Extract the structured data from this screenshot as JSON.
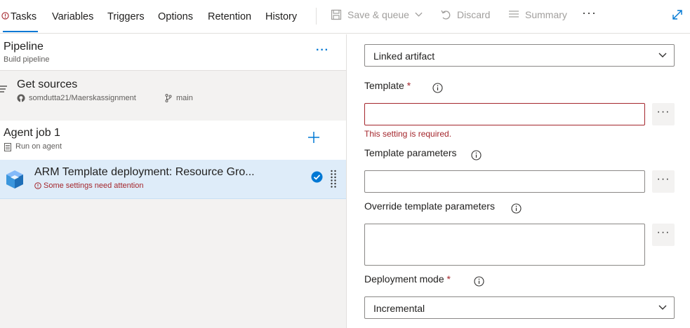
{
  "tabs": [
    {
      "label": "Tasks"
    },
    {
      "label": "Variables"
    },
    {
      "label": "Triggers"
    },
    {
      "label": "Options"
    },
    {
      "label": "Retention"
    },
    {
      "label": "History"
    }
  ],
  "toolbar": {
    "save_label": "Save & queue",
    "discard_label": "Discard",
    "summary_label": "Summary",
    "more_label": "···"
  },
  "pipeline": {
    "title": "Pipeline",
    "subtitle": "Build pipeline",
    "more_label": "···"
  },
  "sources": {
    "title": "Get sources",
    "repo": "somdutta21/Maerskassignment",
    "branch": "main"
  },
  "agent_job": {
    "title": "Agent job 1",
    "subtitle": "Run on agent"
  },
  "task": {
    "title": "ARM Template deployment: Resource Gro...",
    "warning": "Some settings need attention"
  },
  "form": {
    "template_location_value": "Linked artifact",
    "template_label": "Template",
    "template_value": "",
    "template_error": "This setting is required.",
    "template_params_label": "Template parameters",
    "template_params_value": "",
    "override_label": "Override template parameters",
    "override_value": "",
    "deployment_mode_label": "Deployment mode",
    "deployment_mode_value": "Incremental",
    "required_mark": "*",
    "ellipsis": "···"
  },
  "colors": {
    "accent": "#0078d4",
    "error": "#a4262c",
    "selected_row": "#deecf9"
  }
}
